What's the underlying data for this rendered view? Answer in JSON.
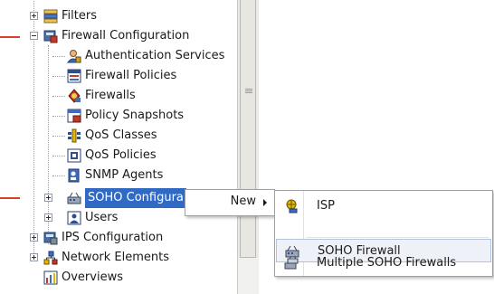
{
  "tree": {
    "items": [
      {
        "label": "Filters",
        "icon": "filter-icon"
      },
      {
        "label": "Firewall Configuration",
        "icon": "firewall-config-icon"
      },
      {
        "label": "Authentication Services",
        "icon": "auth-user-icon"
      },
      {
        "label": "Firewall Policies",
        "icon": "policy-icon"
      },
      {
        "label": "Firewalls",
        "icon": "firewall-icon"
      },
      {
        "label": "Policy Snapshots",
        "icon": "snapshot-icon"
      },
      {
        "label": "QoS Classes",
        "icon": "qos-class-icon"
      },
      {
        "label": "QoS Policies",
        "icon": "qos-policy-icon"
      },
      {
        "label": "SNMP Agents",
        "icon": "snmp-agent-icon"
      },
      {
        "label": "SOHO Configura",
        "icon": "soho-config-icon"
      },
      {
        "label": "Users",
        "icon": "users-icon"
      },
      {
        "label": "IPS Configuration",
        "icon": "ips-config-icon"
      },
      {
        "label": "Network Elements",
        "icon": "network-elements-icon"
      },
      {
        "label": "Overviews",
        "icon": "overviews-icon"
      }
    ]
  },
  "context_menu": {
    "new_label": "New"
  },
  "submenu": {
    "items": [
      {
        "label": "ISP",
        "icon": "isp-icon"
      },
      {
        "label": "SOHO Firewall",
        "icon": "soho-firewall-icon"
      },
      {
        "label": "Multiple SOHO Firewalls",
        "icon": "multiple-soho-firewalls-icon"
      }
    ]
  },
  "colors": {
    "selection": "#316ac5",
    "callout": "#d8402a",
    "menu_hover": "#eef2f8"
  }
}
